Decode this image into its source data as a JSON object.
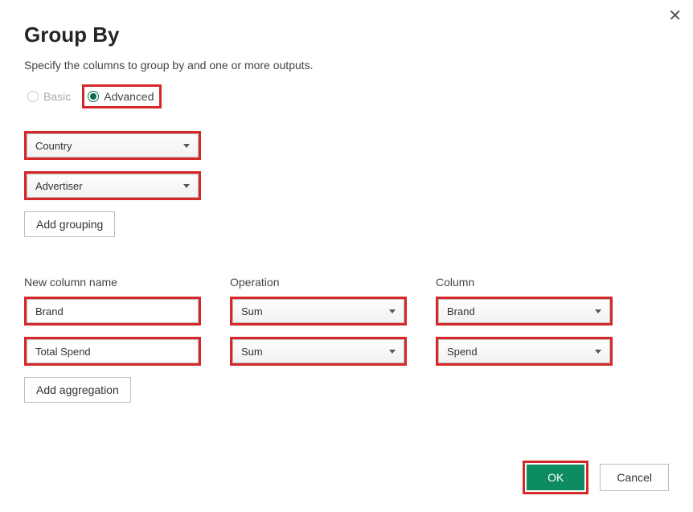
{
  "dialog": {
    "title": "Group By",
    "subtitle": "Specify the columns to group by and one or more outputs."
  },
  "mode": {
    "basic_label": "Basic",
    "advanced_label": "Advanced",
    "selected": "Advanced"
  },
  "group_columns": [
    {
      "value": "Country"
    },
    {
      "value": "Advertiser"
    }
  ],
  "buttons": {
    "add_grouping": "Add grouping",
    "add_aggregation": "Add aggregation",
    "ok": "OK",
    "cancel": "Cancel"
  },
  "agg_headers": {
    "name": "New column name",
    "operation": "Operation",
    "column": "Column"
  },
  "aggregations": [
    {
      "name": "Brand",
      "operation": "Sum",
      "column": "Brand"
    },
    {
      "name": "Total Spend",
      "operation": "Sum",
      "column": "Spend"
    }
  ],
  "highlight_color": "#d62828",
  "accent_color": "#0d8b63"
}
